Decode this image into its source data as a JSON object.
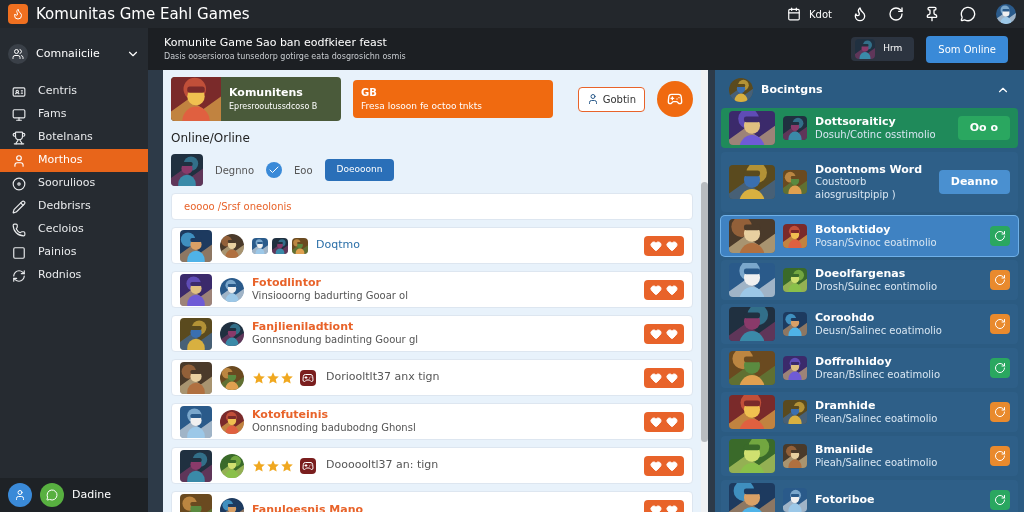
{
  "app": {
    "title": "Komunitas Gme Eahl Games",
    "user_label": "Kdot"
  },
  "sidebar": {
    "group": {
      "label": "Comnaiiciie",
      "expanded": true
    },
    "items": [
      {
        "label": "Centris",
        "selected": false
      },
      {
        "label": "Fams",
        "selected": false
      },
      {
        "label": "Botelnans",
        "selected": false
      },
      {
        "label": "Morthos",
        "selected": true
      },
      {
        "label": "Soorulioos",
        "selected": false
      },
      {
        "label": "Dedbrisrs",
        "selected": false
      },
      {
        "label": "Cecloios",
        "selected": false
      },
      {
        "label": "Painios",
        "selected": false
      },
      {
        "label": "Rodnios",
        "selected": false
      }
    ],
    "footer_label": "Dadine"
  },
  "header": {
    "title": "Komunite Game Sao ban eodfkieer feast",
    "subtitle": "Dasis oosersioroa tunsedorp gotirge eata dosgrosichn osmis",
    "user_chip": "Hrm",
    "primary_button": "Som Online"
  },
  "banner": {
    "title": "Komunitens",
    "subtitle": "Epresrooutussdcoso B",
    "callout_title": "GB",
    "callout_text": "Fresa losoon fe octoo tnkts",
    "join_button": "Gobtin"
  },
  "online": {
    "heading": "Online/Orline",
    "name": "Degnno",
    "verified": true,
    "tag": "Eoo",
    "button": "Doeooonn",
    "notice": "eoooo /Srsf oneolonis"
  },
  "feed": [
    {
      "kind": "badges",
      "text": "Doqtmo"
    },
    {
      "kind": "post",
      "title": "Fotodlintor",
      "subtitle": "Vinsiooorng badurting Gooar ol"
    },
    {
      "kind": "post",
      "title": "Fanjlieniladtiont",
      "subtitle": "Gonnsnodung badinting Goour gl"
    },
    {
      "kind": "rated",
      "stars": 3,
      "text": "Doriooltlt37 anx tign"
    },
    {
      "kind": "post",
      "title": "Kotofuteinis",
      "subtitle": "Oonnsnoding badubodng Ghonsl"
    },
    {
      "kind": "rated",
      "stars": 3,
      "text": "Doooooltl37 an: tign"
    },
    {
      "kind": "post",
      "title": "Fanuloesnis Mano"
    }
  ],
  "friends": {
    "heading": "Bocintgns",
    "expanded": true,
    "items": [
      {
        "title": "Dottsoraiticy",
        "subtitle": "Dosuh/Cotinc osstimolio",
        "selected": true,
        "highlighted": false,
        "action": {
          "kind": "text",
          "label": "Oo o",
          "color": "#2aa760"
        }
      },
      {
        "title": "Doontnoms Word",
        "subtitle": "Coustoorb aiosgrusitpipip )",
        "selected": false,
        "highlighted": false,
        "action": {
          "kind": "text",
          "label": "Deanno",
          "color": "#4a90d0"
        }
      },
      {
        "title": "Botonktidoy",
        "subtitle": "Posan/Svinoc eoatimolio",
        "selected": false,
        "highlighted": true,
        "action": {
          "kind": "icon",
          "color": "#2aa760"
        }
      },
      {
        "title": "Doeolfargenas",
        "subtitle": "Drosh/Suinec eontimolio",
        "selected": false,
        "highlighted": false,
        "action": {
          "kind": "icon",
          "color": "#e98a2d"
        }
      },
      {
        "title": "Coroohdo",
        "subtitle": "Deusn/Salinec eoatimolio",
        "selected": false,
        "highlighted": false,
        "action": {
          "kind": "icon",
          "color": "#e98a2d"
        }
      },
      {
        "title": "Doffrolhidoy",
        "subtitle": "Drean/Bslinec eoatimolio",
        "selected": false,
        "highlighted": false,
        "action": {
          "kind": "icon",
          "color": "#2aa760"
        }
      },
      {
        "title": "Dramhide",
        "subtitle": "Piean/Salinec eoatimolio",
        "selected": false,
        "highlighted": false,
        "action": {
          "kind": "icon",
          "color": "#e98a2d"
        }
      },
      {
        "title": "Bmaniide",
        "subtitle": "Pieah/Salinec eoatimolio",
        "selected": false,
        "highlighted": false,
        "action": {
          "kind": "icon",
          "color": "#e98a2d"
        }
      },
      {
        "title": "Fotoriboe",
        "selected": false,
        "highlighted": false,
        "action": {
          "kind": "icon",
          "color": "#2aa760"
        }
      }
    ]
  }
}
